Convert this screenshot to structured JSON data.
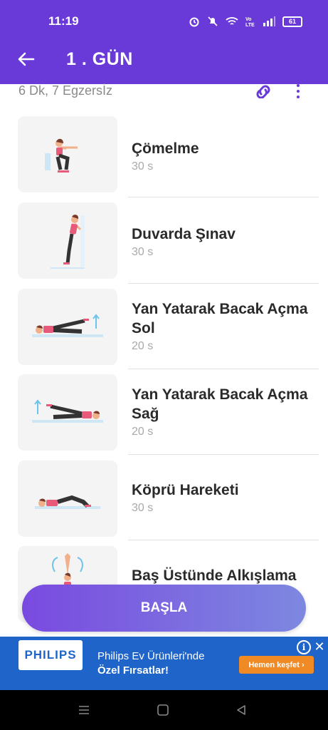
{
  "status_bar": {
    "time": "11:19",
    "battery": "61"
  },
  "toolbar": {
    "title": "1 . GÜN"
  },
  "summary": {
    "text": "6 Dk, 7 Egzersİz"
  },
  "exercises": [
    {
      "name": "Çömelme",
      "duration": "30 s"
    },
    {
      "name": "Duvarda Şınav",
      "duration": "30 s"
    },
    {
      "name": "Yan Yatarak Bacak Açma Sol",
      "duration": "20 s"
    },
    {
      "name": "Yan Yatarak Bacak Açma Sağ",
      "duration": "20 s"
    },
    {
      "name": "Köprü Hareketi",
      "duration": "30 s"
    },
    {
      "name": "Baş Üstünde Alkışlama",
      "duration": ""
    }
  ],
  "start_button": {
    "label": "BAŞLA"
  },
  "ad": {
    "brand": "PHILIPS",
    "line1": "Philips Ev Ürünleri'nde",
    "line2": "Özel Fırsatlar!",
    "cta": "Hemen keşfet ›"
  },
  "colors": {
    "primary": "#6a3ad8",
    "button_gradient_end": "#7d88e0",
    "ad_blue": "#1f64c8",
    "cta_orange": "#f08a24"
  }
}
